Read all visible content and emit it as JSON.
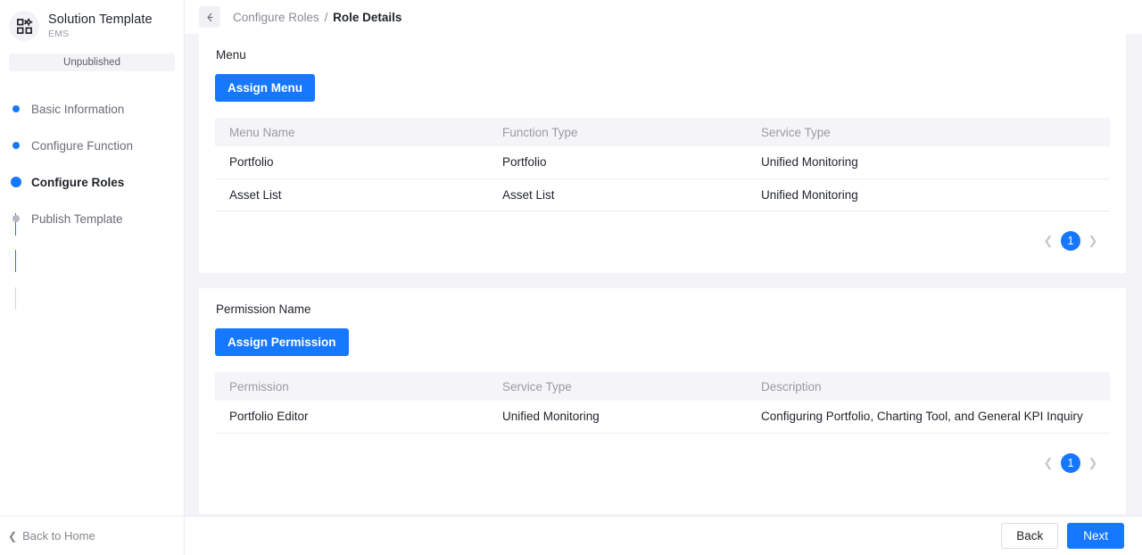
{
  "sidebar": {
    "logo_icon": "apps-grid-gear-icon",
    "title": "Solution Template",
    "subtitle": "EMS",
    "status_badge": "Unpublished",
    "steps": [
      {
        "label": "Basic Information",
        "state": "done"
      },
      {
        "label": "Configure Function",
        "state": "done"
      },
      {
        "label": "Configure Roles",
        "state": "active"
      },
      {
        "label": "Publish Template",
        "state": "pending"
      }
    ],
    "back_home": "Back to Home",
    "back_home_icon": "chevron-left-icon"
  },
  "topbar": {
    "back_icon": "arrow-left-icon",
    "breadcrumb_parent": "Configure Roles",
    "breadcrumb_separator": "/",
    "breadcrumb_current": "Role Details"
  },
  "menu_section": {
    "label": "Menu",
    "assign_button": "Assign Menu",
    "columns": [
      "Menu Name",
      "Function Type",
      "Service Type"
    ],
    "rows": [
      [
        "Portfolio",
        "Portfolio",
        "Unified Monitoring"
      ],
      [
        "Asset List",
        "Asset List",
        "Unified Monitoring"
      ]
    ],
    "pager": {
      "prev_icon": "chevron-left-icon",
      "page": "1",
      "next_icon": "chevron-right-icon"
    }
  },
  "permission_section": {
    "label": "Permission Name",
    "assign_button": "Assign Permission",
    "columns": [
      "Permission",
      "Service Type",
      "Description"
    ],
    "rows": [
      [
        "Portfolio Editor",
        "Unified Monitoring",
        "Configuring Portfolio, Charting Tool, and General KPI Inquiry"
      ]
    ],
    "pager": {
      "prev_icon": "chevron-left-icon",
      "page": "1",
      "next_icon": "chevron-right-icon"
    }
  },
  "footer": {
    "back_label": "Back",
    "next_label": "Next"
  },
  "colors": {
    "accent": "#1677ff",
    "page_bg": "#f4f4f8",
    "header_bg": "#f5f5f9",
    "text": "#1f2329",
    "muted": "#9a9aa6"
  }
}
